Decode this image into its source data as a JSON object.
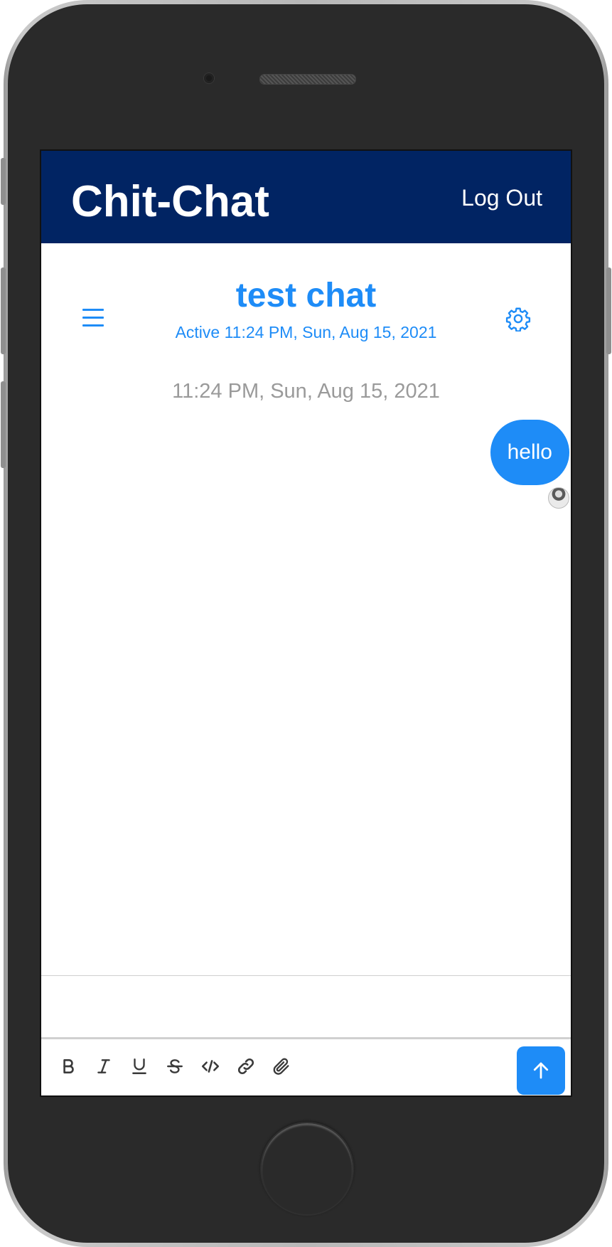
{
  "app": {
    "title": "Chit-Chat",
    "logout_label": "Log Out"
  },
  "chat": {
    "name": "test chat",
    "status": "Active 11:24 PM, Sun, Aug 15, 2021"
  },
  "messages": [
    {
      "timestamp": "11:24 PM, Sun, Aug 15, 2021",
      "text": "hello",
      "sender": "self"
    }
  ],
  "composer": {
    "value": "",
    "placeholder": ""
  },
  "toolbar": {
    "tools": [
      "bold-icon",
      "italic-icon",
      "underline-icon",
      "strikethrough-icon",
      "code-icon",
      "link-icon",
      "attachment-icon"
    ],
    "send_icon": "arrow-up-icon"
  },
  "colors": {
    "header_bg": "#012463",
    "accent": "#1e8cf7",
    "timestamp_text": "#9a9a9a"
  }
}
